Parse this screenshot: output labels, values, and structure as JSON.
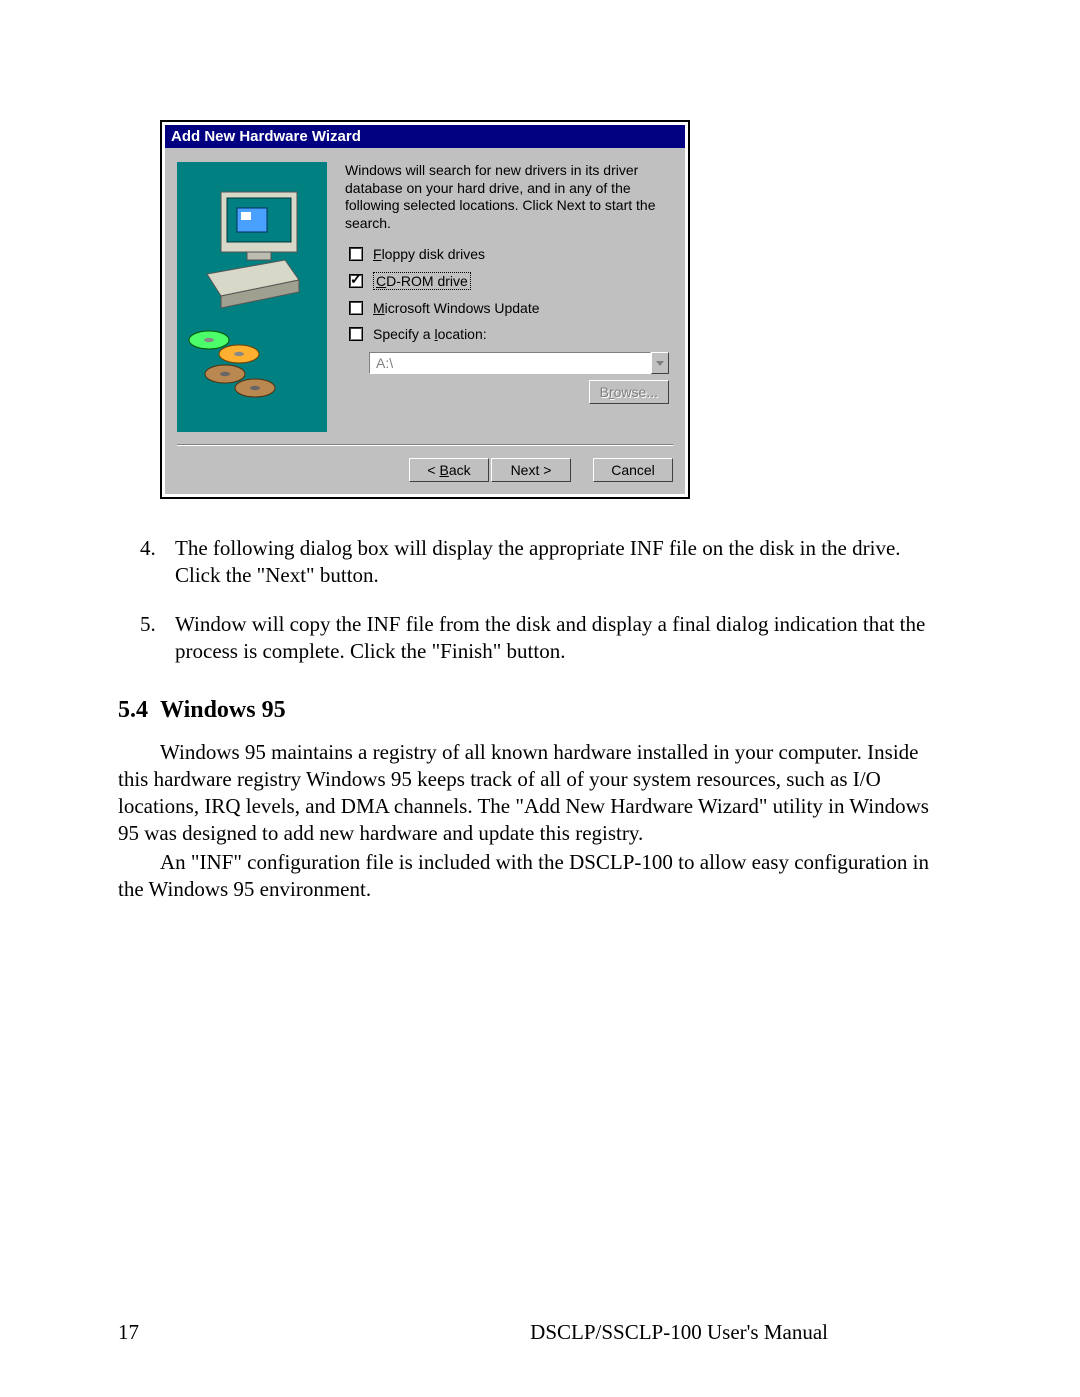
{
  "dialog": {
    "title": "Add New Hardware Wizard",
    "instruction": "Windows will search for new drivers in its driver database on your hard drive, and in any of the following selected locations. Click Next to start the search.",
    "options": {
      "floppy": {
        "label_pre": "F",
        "label_rest": "loppy disk drives",
        "checked": false
      },
      "cdrom": {
        "label_pre": "C",
        "label_rest": "D-ROM drive",
        "checked": true,
        "selected": true
      },
      "winupdate": {
        "label_pre": "M",
        "label_rest": "icrosoft Windows Update",
        "checked": false
      },
      "specify": {
        "label_pre": "Specify a ",
        "label_u": "l",
        "label_post": "ocation:",
        "checked": false
      }
    },
    "location_value": "A:\\",
    "browse_label_pre": "B",
    "browse_label_u": "r",
    "browse_label_post": "owse...",
    "buttons": {
      "back_pre": "< ",
      "back_u": "B",
      "back_post": "ack",
      "next": "Next >",
      "cancel": "Cancel"
    }
  },
  "doc": {
    "step4_num": "4.",
    "step4_text": "The following dialog box will display the appropriate INF file on the disk in the drive. Click the \"Next\" button.",
    "step5_num": "5.",
    "step5_text": "Window will copy the INF file from the disk and display a final dialog  indication that the process is complete. Click the \"Finish\" button.",
    "section_num": "5.4",
    "section_title": "Windows 95",
    "para1": "Windows 95 maintains a registry of all known hardware installed in your computer.  Inside this hardware registry Windows 95 keeps track of all of your system resources, such as I/O locations, IRQ levels, and DMA channels.  The \"Add New Hardware Wizard\" utility in Windows 95 was designed to add new hardware and update this registry.",
    "para2": "An \"INF\" configuration file is included with the DSCLP-100 to allow easy configuration in the Windows 95 environment."
  },
  "footer": {
    "page": "17",
    "title": "DSCLP/SSCLP-100 User's Manual"
  }
}
